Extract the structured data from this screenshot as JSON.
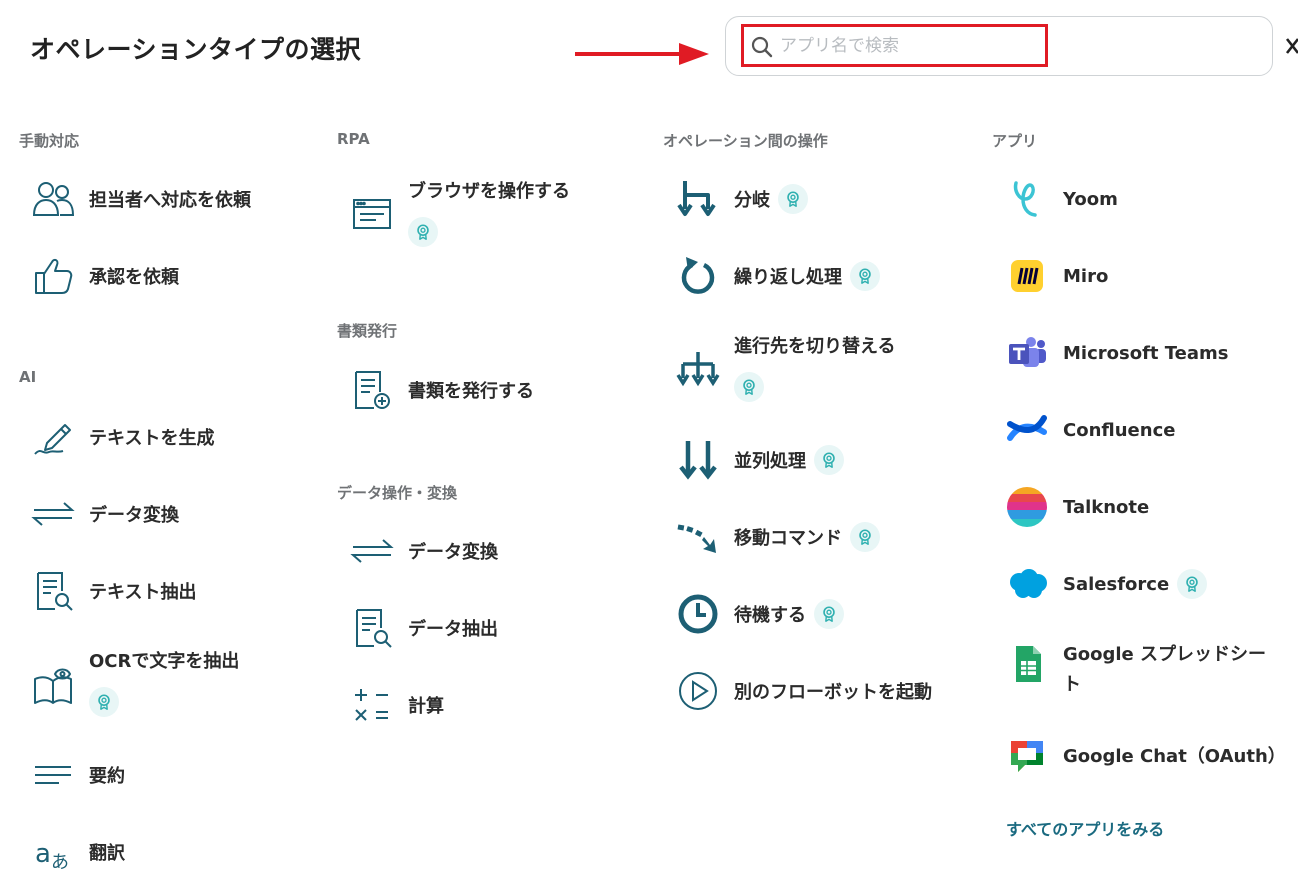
{
  "title": "オペレーションタイプの選択",
  "search": {
    "placeholder": "アプリ名で検索",
    "value": ""
  },
  "sections": {
    "manual": "手動対応",
    "ai": "AI",
    "rpa": "RPA",
    "docs": "書類発行",
    "dataops": "データ操作・変換",
    "flow": "オペレーション間の操作",
    "apps": "アプリ"
  },
  "items": {
    "request_assignee": "担当者へ対応を依頼",
    "request_approval": "承認を依頼",
    "generate_text": "テキストを生成",
    "ai_data_convert": "データ変換",
    "extract_text": "テキスト抽出",
    "ocr_extract": "OCRで文字を抽出",
    "summarize": "要約",
    "translate": "翻訳",
    "browser": "ブラウザを操作する",
    "issue_doc": "書類を発行する",
    "data_convert": "データ変換",
    "data_extract": "データ抽出",
    "calculate": "計算",
    "branch": "分岐",
    "loop": "繰り返し処理",
    "switch": "進行先を切り替える",
    "parallel": "並列処理",
    "move_command": "移動コマンド",
    "wait": "待機する",
    "launch_robot": "別のフローボットを起動"
  },
  "apps": {
    "yoom": "Yoom",
    "miro": "Miro",
    "teams": "Microsoft Teams",
    "confluence": "Confluence",
    "talknote": "Talknote",
    "salesforce": "Salesforce",
    "sheets": "Google スプレッドシート",
    "chat": "Google Chat（OAuth）"
  },
  "all_apps_link": "すべてのアプリをみる",
  "colors": {
    "icon": "#1d5f74",
    "link": "#1a6a80",
    "highlight": "#e01b24",
    "badge_bg": "#e8f6f6",
    "badge_icon": "#2fb0b0"
  }
}
